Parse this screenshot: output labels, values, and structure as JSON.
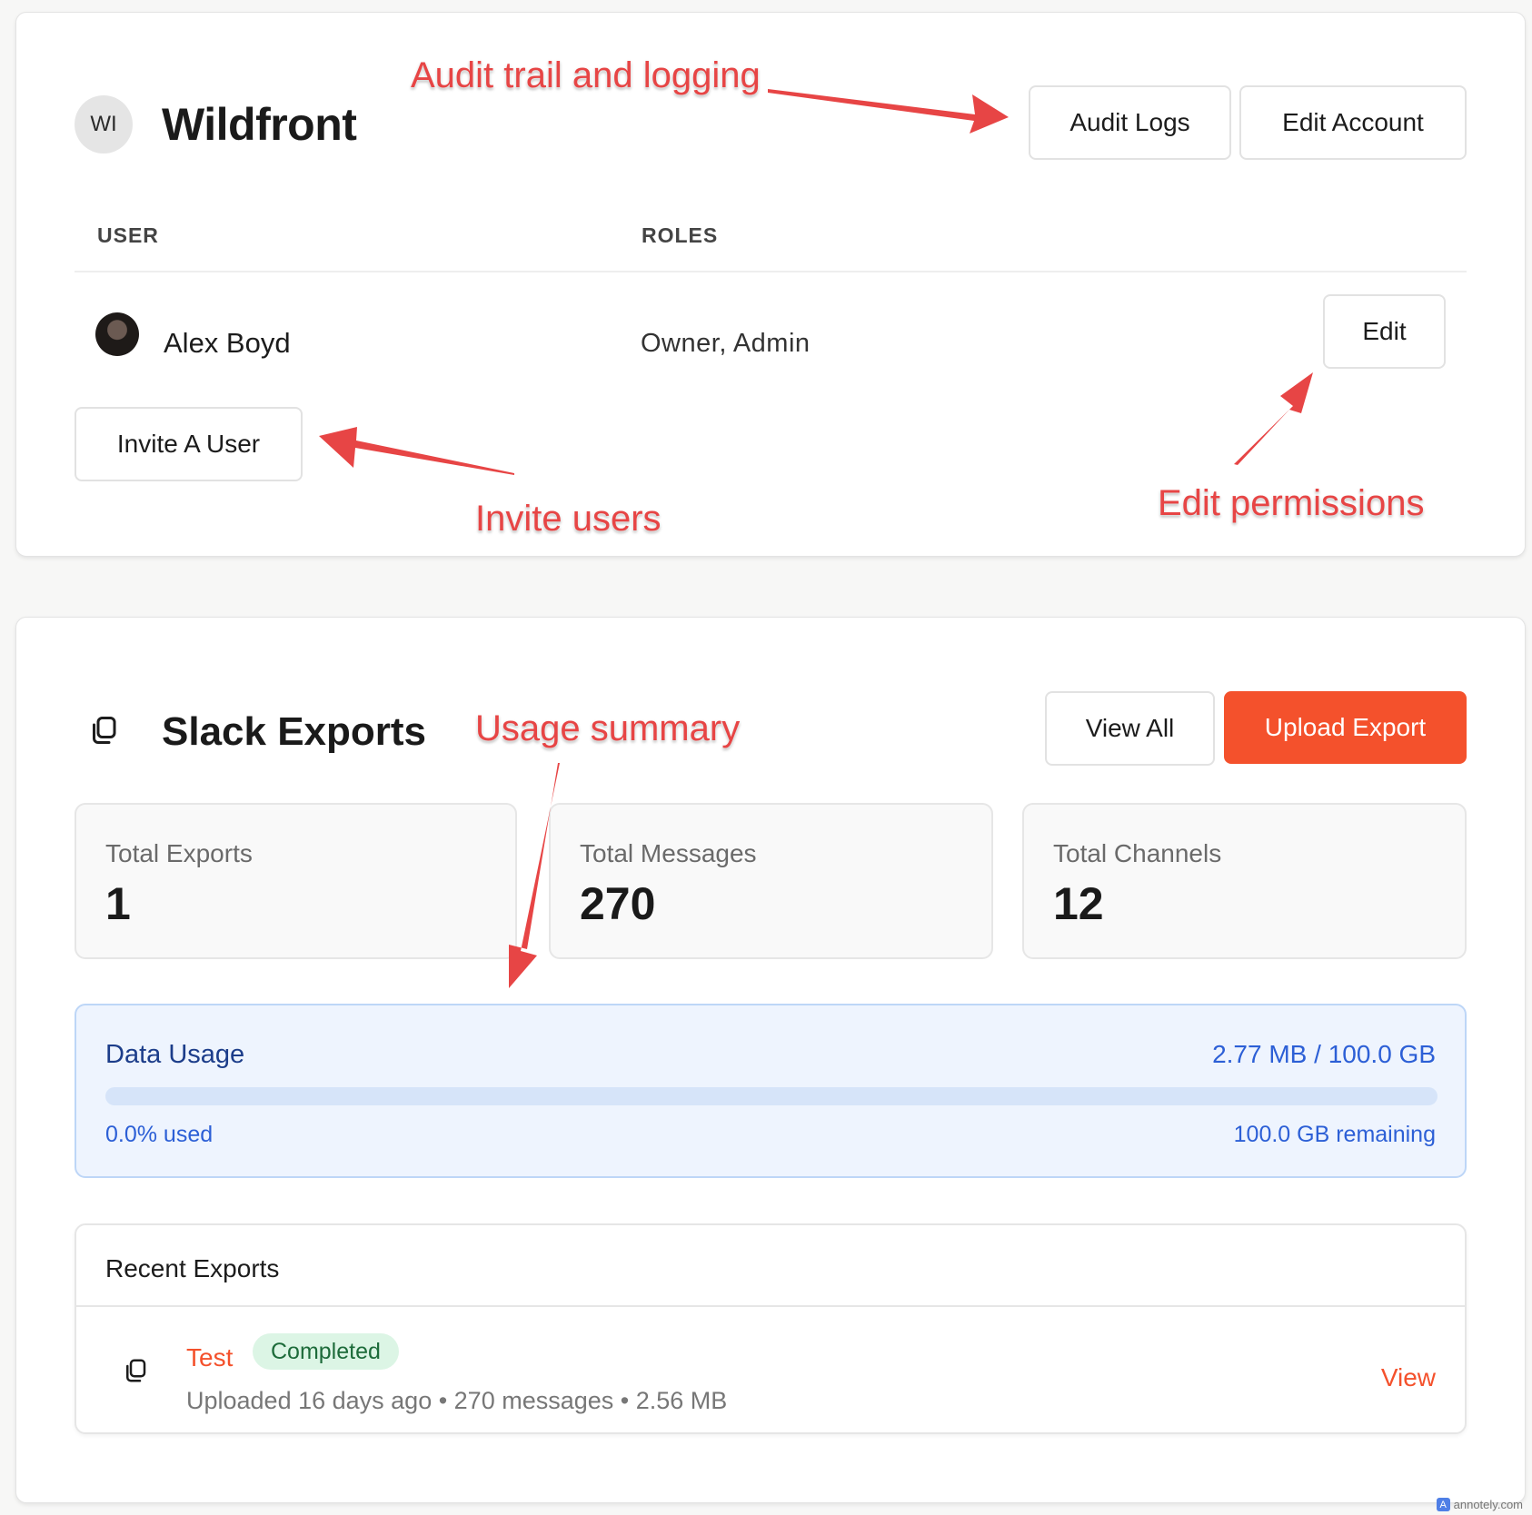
{
  "org": {
    "initials": "WI",
    "name": "Wildfront",
    "audit_logs_label": "Audit Logs",
    "edit_account_label": "Edit Account"
  },
  "users_table": {
    "headers": [
      "USER",
      "ROLES"
    ],
    "rows": [
      {
        "name": "Alex Boyd",
        "roles": "Owner, Admin",
        "edit_label": "Edit"
      }
    ],
    "invite_label": "Invite A User"
  },
  "annotations": {
    "audit": "Audit trail and logging",
    "invite": "Invite users",
    "edit": "Edit permissions",
    "usage": "Usage summary"
  },
  "exports": {
    "title": "Slack Exports",
    "view_all_label": "View All",
    "upload_label": "Upload Export",
    "stats": [
      {
        "label": "Total Exports",
        "value": "1"
      },
      {
        "label": "Total Messages",
        "value": "270"
      },
      {
        "label": "Total Channels",
        "value": "12"
      }
    ],
    "usage": {
      "title": "Data Usage",
      "amount": "2.77 MB / 100.0 GB",
      "percent_used": 0.0,
      "used_text": "0.0% used",
      "remaining_text": "100.0 GB remaining"
    },
    "recent": {
      "title": "Recent Exports",
      "items": [
        {
          "name": "Test",
          "status": "Completed",
          "meta": "Uploaded 16 days ago • 270 messages • 2.56 MB",
          "view_label": "View"
        }
      ]
    }
  },
  "watermark": "annotely.com",
  "colors": {
    "accent": "#f4512c",
    "annotation": "#e74545",
    "usage_blue": "#2c5fd6",
    "success_bg": "#dcf5e5",
    "success_text": "#1d6b3a"
  }
}
